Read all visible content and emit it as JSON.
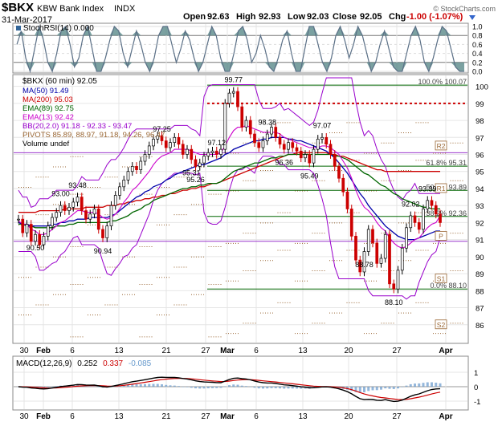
{
  "header": {
    "symbol": "$BKX",
    "name": "KBW Bank Index",
    "exchange": "INDX",
    "date": "31-Mar-2017",
    "open_label": "Open",
    "open": "92.63",
    "high_label": "High",
    "high": "92.93",
    "low_label": "Low",
    "low": "92.03",
    "close_label": "Close",
    "close": "92.05",
    "chg_label": "Chg",
    "chg": "-1.00 (-1.07%)",
    "watermark": "© StockCharts.com",
    "chg_color": "#cc0000"
  },
  "stochrsi": {
    "label": "StochRSI(14) 0.000",
    "ticks": [
      "1.0",
      "0.8",
      "0.6",
      "0.4",
      "0.2",
      "0.0"
    ],
    "series": [
      0.6,
      0.9,
      0.3,
      0.0,
      0.5,
      1.0,
      0.7,
      0.2,
      0.0,
      0.4,
      0.9,
      1.0,
      0.6,
      0.1,
      0.3,
      0.8,
      1.0,
      0.5,
      0.0,
      0.0,
      0.3,
      0.7,
      1.0,
      0.9,
      0.4,
      0.1,
      0.5,
      0.9,
      0.6,
      0.2,
      0.0,
      0.3,
      0.8,
      1.0,
      1.0,
      0.6,
      0.2,
      0.5,
      0.9,
      0.7,
      0.3,
      0.0,
      0.2,
      0.6,
      1.0,
      0.8,
      0.3,
      0.0,
      0.0,
      0.4,
      0.9,
      1.0,
      0.7,
      0.2,
      0.4,
      0.8,
      0.5,
      0.1,
      0.0,
      0.3,
      0.7,
      0.9,
      0.4,
      0.0,
      0.0,
      0.5,
      1.0,
      1.0,
      0.6,
      0.2,
      0.0,
      0.3,
      0.8,
      1.0,
      0.7,
      0.3,
      0.6,
      1.0,
      0.8,
      0.4,
      0.0,
      0.2,
      0.6,
      0.9,
      0.5,
      0.1,
      0.0,
      0.0,
      0.4,
      0.8,
      1.0,
      0.7,
      0.2,
      0.0,
      0.3,
      0.7,
      1.0,
      0.9,
      0.5,
      0.1,
      0.0,
      0.0
    ]
  },
  "main": {
    "legend": [
      {
        "text": "$BKX (60 min) 92.05",
        "color": "#000000"
      },
      {
        "text": "MA(50) 91.49",
        "color": "#0000aa"
      },
      {
        "text": "MA(200) 95.03",
        "color": "#cc0000"
      },
      {
        "text": "EMA(89) 92.75",
        "color": "#006600"
      },
      {
        "text": "EMA(13) 92.42",
        "color": "#cc00cc"
      },
      {
        "text": "BB(20,2.0) 91.18 - 92.33 - 93.47",
        "color": "#9900cc"
      },
      {
        "text": "PIVOTS 85.89, 88.97, 91.18, 94.26, 96.47",
        "color": "#996633"
      },
      {
        "text": "Volume undef",
        "color": "#000000"
      }
    ],
    "y_ticks": [
      "100",
      "99",
      "98",
      "97",
      "96",
      "95",
      "94",
      "93",
      "92",
      "91",
      "90",
      "89",
      "88",
      "87",
      "86"
    ],
    "ylim": [
      85,
      100.5
    ],
    "x_labels": [
      "30",
      "Feb",
      "6",
      "13",
      "21",
      "27",
      "Mar",
      "6",
      "13",
      "20",
      "27",
      "Apr"
    ],
    "fib_labels": [
      "100.0% 100.07",
      "61.8% 95.31",
      "50.0% 93.89",
      "38.2% 92.36",
      "0.0% 88.10"
    ],
    "pivot_labels": [
      "R2",
      "R1",
      "P",
      "S1",
      "S2"
    ],
    "price_annotations": [
      "99.77",
      "98.38",
      "97.25",
      "97.12",
      "97.07",
      "96.36",
      "95.31",
      "95.26",
      "95.49",
      "93.00",
      "93.48",
      "90.50",
      "90.94",
      "92.02",
      "88.78",
      "88.10",
      "93.39"
    ],
    "resistance_level": 99.0,
    "colors": {
      "price": "#000000",
      "ma50": "#0000aa",
      "ma200": "#cc0000",
      "ema89": "#006600",
      "ema13": "#cc00cc",
      "bb": "#9900cc",
      "fib": "#006600",
      "pivot": "#996633"
    }
  },
  "macd": {
    "label": "MACD(12,26,9)",
    "macd_value": "0.252",
    "signal_value": "0.337",
    "hist_value": "-0.085",
    "ticks": [
      "1",
      "0",
      "-1"
    ],
    "colors": {
      "macd": "#000000",
      "signal": "#cc0000",
      "hist": "#6699cc"
    }
  },
  "chart_data": {
    "type": "line",
    "title": "$BKX KBW Bank Index INDX",
    "x": [
      "30",
      "Feb",
      "6",
      "13",
      "21",
      "27",
      "Mar",
      "6",
      "13",
      "20",
      "27",
      "Apr"
    ],
    "series": [
      {
        "name": "$BKX (60 min) 92.05",
        "values": [
          92.2,
          91.4,
          91.9,
          90.9,
          91.3,
          90.7,
          91.2,
          91.8,
          92.3,
          92.6,
          93.0,
          92.7,
          92.9,
          93.2,
          93.5,
          92.7,
          92.2,
          92.5,
          92.8,
          91.6,
          91.1,
          91.8,
          93.0,
          93.6,
          94.1,
          94.5,
          95.0,
          95.3,
          95.1,
          95.6,
          96.0,
          96.5,
          96.9,
          97.1,
          96.8,
          96.4,
          96.7,
          97.0,
          96.6,
          96.0,
          96.3,
          95.7,
          95.3,
          95.5,
          95.9,
          96.1,
          96.2,
          96.0,
          96.3,
          99.0,
          99.6,
          99.7,
          98.8,
          97.6,
          98.0,
          97.2,
          96.7,
          96.4,
          96.8,
          97.2,
          97.6,
          97.0,
          96.6,
          96.3,
          96.7,
          96.4,
          96.2,
          95.8,
          96.0,
          95.5,
          96.3,
          96.9,
          97.0,
          96.6,
          96.0,
          95.3,
          94.6,
          93.8,
          92.8,
          91.2,
          89.8,
          89.1,
          90.3,
          91.6,
          90.8,
          89.6,
          89.9,
          91.3,
          88.4,
          88.1,
          89.2,
          90.5,
          91.7,
          92.4,
          92.0,
          91.6,
          92.8,
          93.3,
          93.0,
          92.5,
          92.0
        ]
      },
      {
        "name": "MA(50) 91.49",
        "values": [
          92.0,
          91.9,
          91.9,
          91.8,
          91.8,
          91.8,
          91.8,
          91.8,
          91.9,
          91.9,
          92.0,
          92.0,
          92.1,
          92.1,
          92.2,
          92.2,
          92.2,
          92.3,
          92.3,
          92.3,
          92.3,
          92.3,
          92.4,
          92.5,
          92.7,
          92.9,
          93.1,
          93.3,
          93.5,
          93.6,
          93.8,
          93.9,
          94.1,
          94.2,
          94.3,
          94.5,
          94.6,
          94.8,
          94.9,
          95.0,
          95.1,
          95.2,
          95.3,
          95.4,
          95.4,
          95.5,
          95.6,
          95.7,
          95.8,
          96.0,
          96.1,
          96.3,
          96.4,
          96.5,
          96.6,
          96.7,
          96.8,
          96.8,
          96.9,
          96.9,
          97.0,
          97.0,
          97.0,
          97.0,
          96.9,
          96.9,
          96.8,
          96.8,
          96.7,
          96.6,
          96.5,
          96.4,
          96.3,
          96.2,
          96.0,
          95.8,
          95.5,
          95.2,
          94.9,
          94.5,
          94.1,
          93.7,
          93.4,
          93.0,
          92.7,
          92.4,
          92.1,
          91.8,
          91.6,
          91.4,
          91.2,
          91.1,
          91.0,
          91.0,
          91.0,
          91.1,
          91.2,
          91.3,
          91.4,
          91.5,
          91.5
        ]
      },
      {
        "name": "MA(200) 95.03",
        "values": [
          92.6,
          92.6,
          92.6,
          92.6,
          92.6,
          92.7,
          92.7,
          92.7,
          92.7,
          92.7,
          92.7,
          92.8,
          92.8,
          92.8,
          92.8,
          92.8,
          92.9,
          92.9,
          92.9,
          92.9,
          92.9,
          93.0,
          93.0,
          93.0,
          93.1,
          93.1,
          93.2,
          93.2,
          93.3,
          93.3,
          93.4,
          93.4,
          93.5,
          93.5,
          93.6,
          93.6,
          93.7,
          93.7,
          93.8,
          93.9,
          93.9,
          94.0,
          94.0,
          94.1,
          94.1,
          94.2,
          94.3,
          94.3,
          94.4,
          94.5,
          94.6,
          94.7,
          94.8,
          94.9,
          95.0,
          95.1,
          95.2,
          95.3,
          95.4,
          95.5,
          95.6,
          95.7,
          95.8,
          95.9,
          96.0,
          96.0,
          96.1,
          96.1,
          96.1,
          96.1,
          96.1,
          96.1,
          96.1,
          96.1,
          96.0,
          96.0,
          95.9,
          95.9,
          95.8,
          95.7,
          95.6,
          95.5,
          95.4,
          95.3,
          95.2,
          95.1,
          95.1,
          95.0,
          95.0,
          95.0,
          95.0,
          95.0,
          95.0,
          95.0,
          95.0,
          95.0,
          95.0,
          95.0,
          95.0,
          95.0,
          95.0
        ]
      },
      {
        "name": "EMA(89) 92.75",
        "values": [
          91.9,
          91.9,
          91.8,
          91.8,
          91.7,
          91.7,
          91.7,
          91.7,
          91.7,
          91.8,
          91.8,
          91.8,
          91.9,
          91.9,
          92.0,
          92.0,
          92.0,
          92.0,
          92.0,
          92.0,
          92.0,
          92.0,
          92.1,
          92.1,
          92.2,
          92.3,
          92.4,
          92.6,
          92.7,
          92.8,
          93.0,
          93.1,
          93.3,
          93.4,
          93.5,
          93.6,
          93.7,
          93.8,
          93.9,
          94.0,
          94.0,
          94.1,
          94.1,
          94.2,
          94.2,
          94.3,
          94.3,
          94.3,
          94.4,
          94.6,
          94.8,
          95.0,
          95.1,
          95.2,
          95.3,
          95.4,
          95.5,
          95.5,
          95.6,
          95.7,
          95.8,
          95.8,
          95.9,
          95.9,
          96.0,
          96.0,
          96.0,
          96.0,
          96.0,
          96.0,
          96.0,
          96.0,
          96.0,
          96.0,
          96.0,
          95.9,
          95.9,
          95.8,
          95.7,
          95.5,
          95.3,
          95.1,
          94.9,
          94.8,
          94.6,
          94.4,
          94.2,
          94.1,
          93.9,
          93.7,
          93.6,
          93.4,
          93.3,
          93.2,
          93.1,
          93.0,
          92.9,
          92.9,
          92.8,
          92.8,
          92.8
        ]
      },
      {
        "name": "EMA(13) 92.42",
        "values": [
          92.1,
          91.9,
          91.9,
          91.6,
          91.5,
          91.3,
          91.3,
          91.4,
          91.6,
          91.8,
          92.0,
          92.1,
          92.3,
          92.5,
          92.7,
          92.7,
          92.6,
          92.6,
          92.6,
          92.5,
          92.3,
          92.2,
          92.3,
          92.5,
          92.8,
          93.2,
          93.5,
          93.9,
          94.1,
          94.4,
          94.7,
          95.0,
          95.4,
          95.7,
          95.9,
          96.0,
          96.1,
          96.3,
          96.3,
          96.3,
          96.3,
          96.2,
          96.1,
          96.0,
          96.0,
          96.0,
          96.0,
          96.0,
          96.1,
          96.5,
          97.0,
          97.4,
          97.6,
          97.6,
          97.7,
          97.6,
          97.5,
          97.4,
          97.3,
          97.3,
          97.3,
          97.3,
          97.2,
          97.0,
          96.9,
          96.8,
          96.7,
          96.6,
          96.5,
          96.4,
          96.4,
          96.4,
          96.5,
          96.5,
          96.4,
          96.2,
          96.0,
          95.6,
          95.2,
          94.6,
          93.9,
          93.3,
          92.9,
          92.7,
          92.4,
          92.0,
          91.7,
          91.5,
          91.1,
          90.8,
          90.6,
          90.5,
          90.6,
          90.8,
          91.0,
          91.1,
          91.4,
          91.7,
          91.9,
          92.0,
          92.4
        ]
      }
    ],
    "annotations": [
      "99.77",
      "98.38",
      "97.25",
      "97.12",
      "97.07",
      "96.36",
      "95.31",
      "95.26",
      "95.49",
      "93.00",
      "93.48",
      "90.50",
      "90.94",
      "92.02",
      "88.78",
      "88.10",
      "93.39"
    ],
    "ylim": [
      85,
      100.5
    ],
    "grid": true,
    "legend_placement": "top-left",
    "ylabel": "",
    "xlabel": ""
  }
}
